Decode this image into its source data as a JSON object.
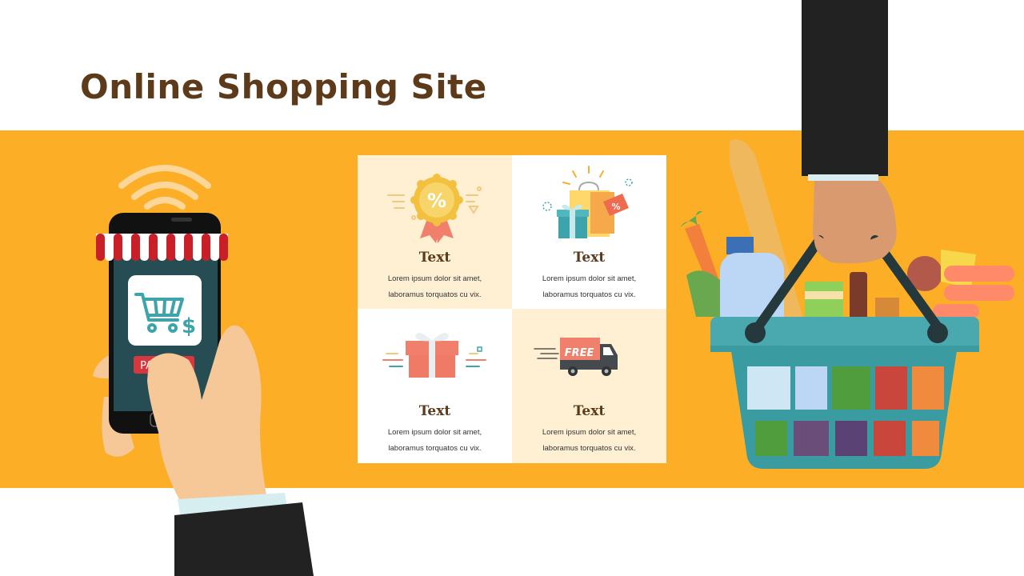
{
  "title": "Online Shopping Site",
  "colors": {
    "accent": "#fcaf26",
    "title": "#5c3a1a",
    "cream": "#fff0d4",
    "white": "#ffffff"
  },
  "phone": {
    "button_label": "PAY NOW",
    "icon": "shopping-cart-dollar-icon"
  },
  "features": [
    {
      "title": "Text",
      "line1": "Lorem ipsum dolor sit amet,",
      "line2": "laboramus torquatos cu vix.",
      "icon": "discount-badge-icon"
    },
    {
      "title": "Text",
      "line1": "Lorem ipsum dolor sit amet,",
      "line2": "laboramus torquatos cu vix.",
      "icon": "shopping-bags-icon"
    },
    {
      "title": "Text",
      "line1": "Lorem ipsum dolor sit amet,",
      "line2": "laboramus torquatos cu vix.",
      "icon": "gift-box-icon"
    },
    {
      "title": "Text",
      "line1": "Lorem ipsum dolor sit amet,",
      "line2": "laboramus torquatos cu vix.",
      "icon": "delivery-truck-icon",
      "truck_label": "FREE"
    }
  ]
}
